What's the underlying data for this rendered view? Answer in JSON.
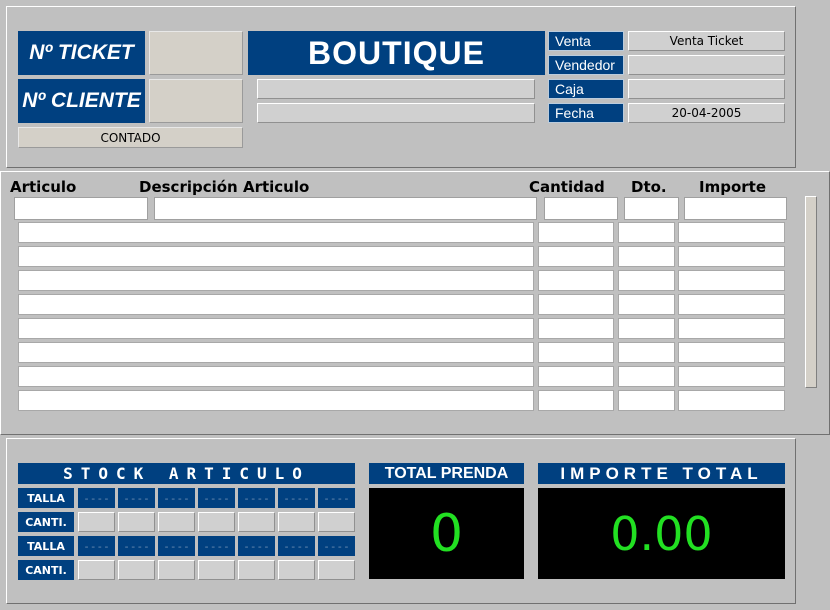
{
  "header": {
    "ticket_label": "Nº TICKET",
    "cliente_label": "Nº CLIENTE",
    "contado_label": "CONTADO",
    "shop_title": "BOUTIQUE",
    "venta_label": "Venta",
    "venta_value": "Venta Ticket",
    "vendedor_label": "Vendedor",
    "caja_label": "Caja",
    "fecha_label": "Fecha",
    "fecha_value": "20-04-2005"
  },
  "lines": {
    "columns": [
      "Articulo",
      "Descripción Articulo",
      "Cantidad",
      "Dto.",
      "Importe"
    ]
  },
  "stock": {
    "title": "STOCK ARTICULO",
    "talla_label": "TALLA",
    "canti_label": "CANTI.",
    "placeholder": "----"
  },
  "totals": {
    "prenda_label": "TOTAL PRENDA",
    "prenda_value": "0",
    "importe_label": "IMPORTE TOTAL",
    "importe_value": "0.00"
  },
  "colors": {
    "accent": "#004080",
    "display_bg": "#000000",
    "display_fg": "#22e022"
  }
}
